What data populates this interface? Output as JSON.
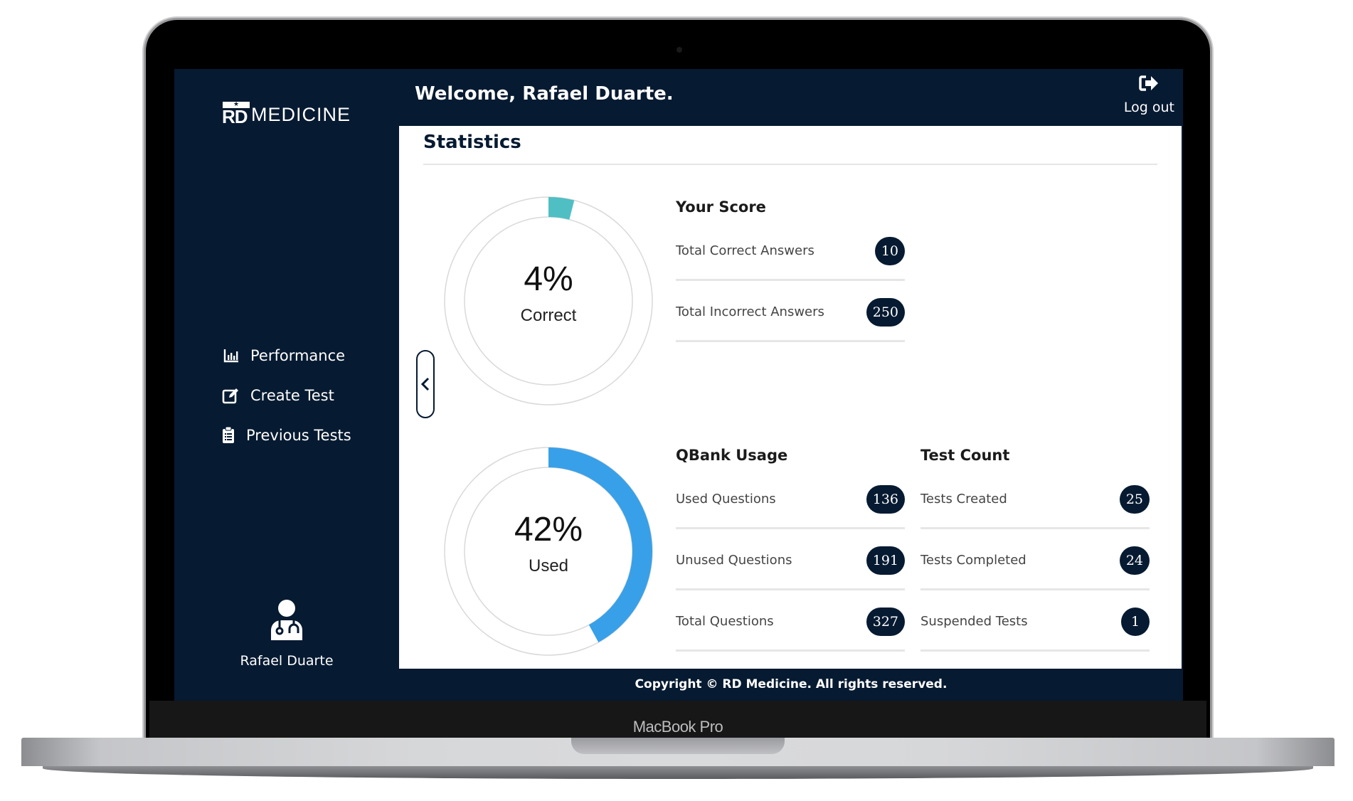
{
  "device": {
    "label": "MacBook Pro"
  },
  "brand": {
    "mark": "RD",
    "name": "MEDICINE"
  },
  "header": {
    "welcome": "Welcome, Rafael Duarte.",
    "logout_label": "Log out"
  },
  "sidebar": {
    "items": [
      {
        "label": "Performance",
        "icon": "bar-chart-icon"
      },
      {
        "label": "Create Test",
        "icon": "edit-icon"
      },
      {
        "label": "Previous Tests",
        "icon": "clipboard-icon"
      }
    ],
    "user": {
      "name": "Rafael Duarte",
      "icon": "user-doctor-icon"
    }
  },
  "main": {
    "title": "Statistics",
    "score_chart": {
      "percent_text": "4%",
      "label": "Correct",
      "fraction": 0.04,
      "color": "#4fbfc4"
    },
    "usage_chart": {
      "percent_text": "42%",
      "label": "Used",
      "fraction": 0.42,
      "color": "#38a0e8"
    },
    "your_score": {
      "title": "Your Score",
      "rows": [
        {
          "label": "Total Correct Answers",
          "value": "10"
        },
        {
          "label": "Total Incorrect Answers",
          "value": "250"
        }
      ]
    },
    "qbank_usage": {
      "title": "QBank Usage",
      "rows": [
        {
          "label": "Used Questions",
          "value": "136"
        },
        {
          "label": "Unused Questions",
          "value": "191"
        },
        {
          "label": "Total Questions",
          "value": "327"
        }
      ]
    },
    "test_count": {
      "title": "Test Count",
      "rows": [
        {
          "label": "Tests Created",
          "value": "25"
        },
        {
          "label": "Tests Completed",
          "value": "24"
        },
        {
          "label": "Suspended Tests",
          "value": "1"
        }
      ]
    }
  },
  "footer": {
    "text": "Copyright © RD Medicine. All rights reserved."
  },
  "colors": {
    "navy": "#061a31",
    "ring": "#d9d9d9"
  }
}
